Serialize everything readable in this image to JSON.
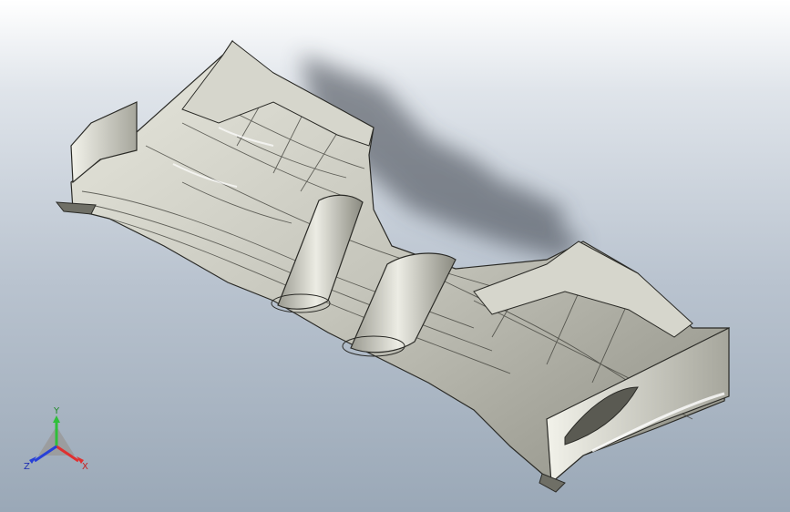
{
  "viewport": {
    "model": "front-wing-assembly",
    "colors": {
      "bg_top": "#ffffff",
      "bg_bottom": "#9aa8b7",
      "surface": "#c9c9bf",
      "surface_light": "#e6e6dc",
      "surface_dark": "#7f7f76",
      "edge": "#2a2a26",
      "shadow": "#3b3f48"
    }
  },
  "triad": {
    "y_label": "Y",
    "x_label": "X",
    "z_label": "Z",
    "colors": {
      "x": "#e03030",
      "y": "#2fbf3a",
      "z": "#2740d8"
    }
  }
}
